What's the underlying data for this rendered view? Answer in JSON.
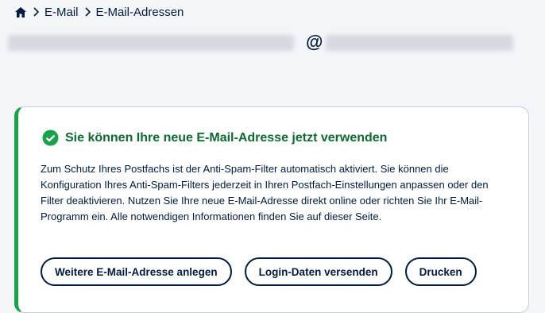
{
  "breadcrumb": {
    "items": [
      "E-Mail",
      "E-Mail-Adressen"
    ]
  },
  "email": {
    "at_symbol": "@"
  },
  "notice": {
    "title": "Sie können Ihre neue E-Mail-Adresse jetzt verwenden",
    "text": "Zum Schutz Ihres Postfachs ist der Anti-Spam-Filter automatisch aktiviert. Sie können die Konfiguration Ihres Anti-Spam-Filters jederzeit in Ihren Postfach-Einstellungen anpassen oder den Filter deaktivieren. Nutzen Sie Ihre neue E-Mail-Adresse direkt online oder richten Sie Ihr E-Mail-Programm ein. Alle notwendigen Informationen finden Sie auf dieser Seite.",
    "buttons": [
      "Weitere E-Mail-Adresse anlegen",
      "Login-Daten versenden",
      "Drucken"
    ]
  },
  "colors": {
    "text": "#001b41",
    "success": "#18a24a",
    "success_text": "#0c6b2e"
  },
  "icons": {
    "home": "home-icon",
    "separator": "chevron-right-icon",
    "status": "check-circle-icon"
  }
}
